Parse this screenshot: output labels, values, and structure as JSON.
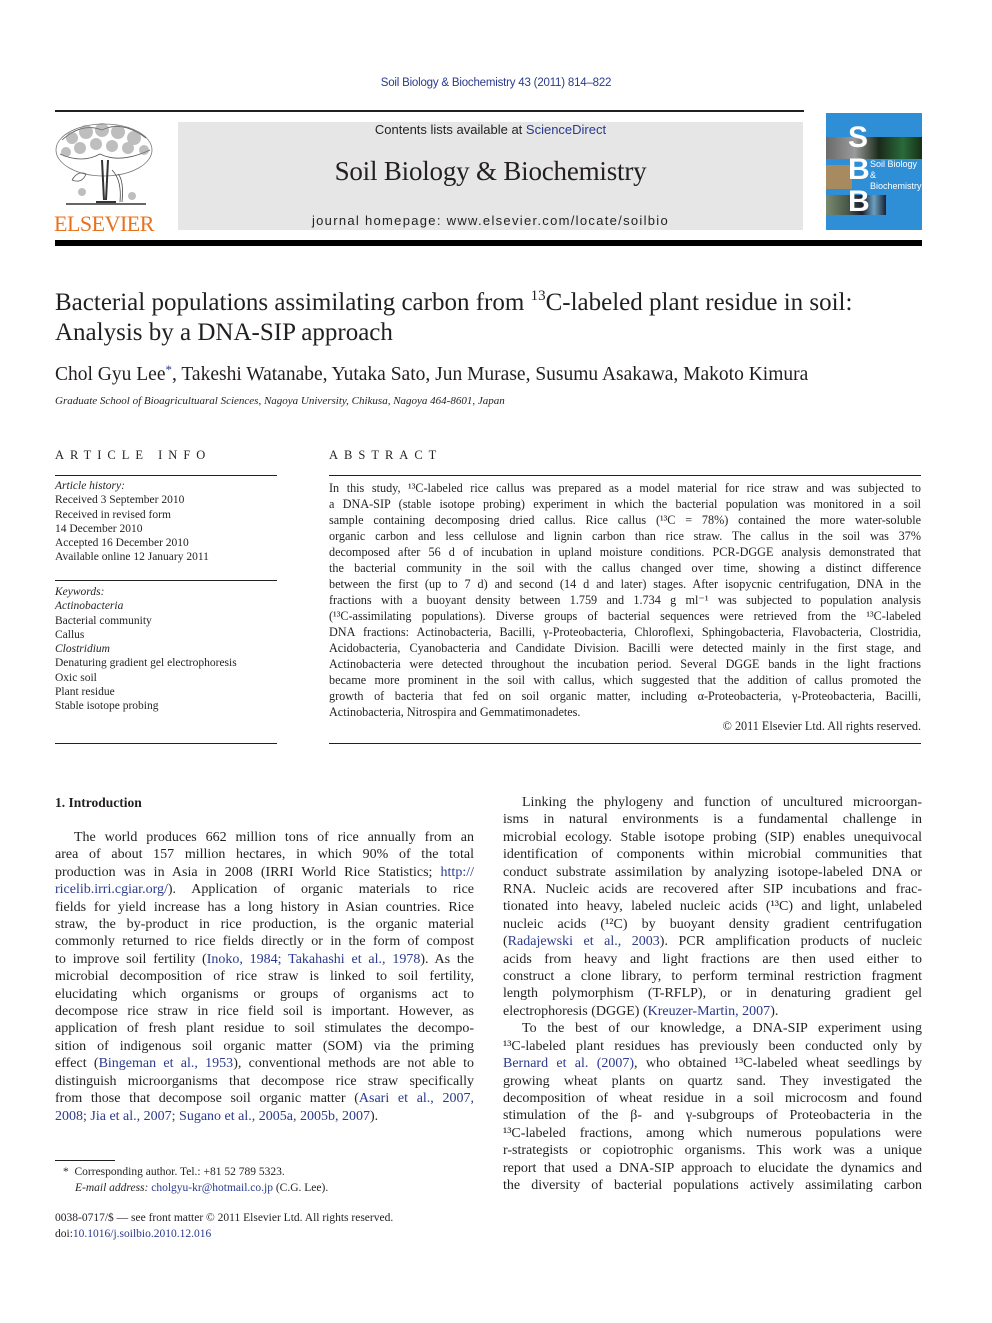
{
  "journal_ref": "Soil Biology & Biochemistry 43 (2011) 814–822",
  "banner": {
    "contents_prefix": "Contents lists available at ",
    "contents_link": "ScienceDirect",
    "journal_name": "Soil Biology & Biochemistry",
    "homepage": "journal homepage: www.elsevier.com/locate/soilbio"
  },
  "publisher_logo_text": "ELSEVIER",
  "cover": {
    "letters": [
      "S",
      "B",
      "B"
    ],
    "caption_line1": "Soil Biology &",
    "caption_line2": "Biochemistry",
    "colors": {
      "background": "#2f8fd6"
    }
  },
  "article": {
    "title_part1": "Bacterial populations assimilating carbon from ",
    "title_sup": "13",
    "title_part2": "C-labeled plant residue in soil:",
    "title_line2": "Analysis by a DNA-SIP approach",
    "first_author": "Chol Gyu Lee",
    "corresponding_mark": "*",
    "other_authors": ", Takeshi Watanabe, Yutaka Sato, Jun Murase, Susumu Asakawa, Makoto Kimura",
    "affiliation": "Graduate School of Bioagricultuaral Sciences, Nagoya University, Chikusa, Nagoya 464-8601, Japan"
  },
  "article_info": {
    "heading": "ARTICLE INFO",
    "history_label": "Article history:",
    "history": [
      "Received 3 September 2010",
      "Received in revised form",
      "14 December 2010",
      "Accepted 16 December 2010",
      "Available online 12 January 2011"
    ],
    "keywords_label": "Keywords:",
    "keywords": [
      {
        "text": "Actinobacteria",
        "italic": true
      },
      {
        "text": "Bacterial community",
        "italic": false
      },
      {
        "text": "Callus",
        "italic": false
      },
      {
        "text": "Clostridium",
        "italic": true
      },
      {
        "text": "Denaturing gradient gel electrophoresis",
        "italic": false
      },
      {
        "text": "Oxic soil",
        "italic": false
      },
      {
        "text": "Plant residue",
        "italic": false
      },
      {
        "text": "Stable isotope probing",
        "italic": false
      }
    ]
  },
  "abstract": {
    "heading": "ABSTRACT",
    "lines": [
      "In this study, ¹³C-labeled rice callus was prepared as a model material for rice straw and was subjected to",
      "a DNA-SIP (stable isotope probing) experiment in which the bacterial population was monitored in a soil",
      "sample containing decomposing dried callus. Rice callus (¹³C = 78%) contained the more water-soluble",
      "organic carbon and less cellulose and lignin carbon than rice straw. The callus in the soil was 37%",
      "decomposed after 56 d of incubation in upland moisture conditions. PCR-DGGE analysis demonstrated that",
      "the bacterial community in the soil with the callus changed over time, showing a distinct difference",
      "between the first (up to 7 d) and second (14 d and later) stages. After isopycnic centrifugation, DNA in the",
      "fractions with a buoyant density between 1.759 and 1.734 g ml⁻¹ was subjected to population analysis",
      "(¹³C-assimilating populations). Diverse groups of bacterial sequences were retrieved from the ¹³C-labeled",
      "DNA fractions: Actinobacteria, Bacilli, γ-Proteobacteria, Chloroflexi, Sphingobacteria, Flavobacteria, Clostridia,",
      "Acidobacteria, Cyanobacteria and Candidate Division. Bacilli were detected mainly in the first stage, and",
      "Actinobacteria were detected throughout the incubation period. Several DGGE bands in the light fractions",
      "became more prominent in the soil with callus, which suggested that the addition of callus promoted the",
      "growth of bacteria that fed on soil organic matter, including α-Proteobacteria, γ-Proteobacteria, Bacilli,",
      "Actinobacteria, Nitrospira and Gemmatimonadetes."
    ],
    "copyright": "© 2011 Elsevier Ltd. All rights reserved."
  },
  "introduction": {
    "heading": "1.  Introduction",
    "col1_lines": [
      "The world produces 662 million tons of rice annually from an",
      "area of about 157 million hectares, in which 90% of the total",
      "production was in Asia in 2008 (IRRI World Rice Statistics; http://",
      "ricelib.irri.cgiar.org/). Application of organic materials to rice",
      "fields for yield increase has a long history in Asian countries. Rice",
      "straw, the by-product in rice production, is the organic material",
      "commonly returned to rice fields directly or in the form of compost",
      "to improve soil fertility (Inoko, 1984; Takahashi et al., 1978). As the",
      "microbial decomposition of rice straw is linked to soil fertility,",
      "elucidating which organisms or groups of organisms act to",
      "decompose rice straw in rice field soil is important. However, as",
      "application of fresh plant residue to soil stimulates the decompo-",
      "sition of indigenous soil organic matter (SOM) via the priming",
      "effect (Bingeman et al., 1953), conventional methods are not able to",
      "distinguish microorganisms that decompose rice straw specifically",
      "from those that decompose soil organic matter (Asari et al., 2007,",
      "2008; Jia et al., 2007; Sugano et al., 2005a, 2005b, 2007)."
    ],
    "col2_lines": [
      "Linking the phylogeny and function of uncultured microorgan-",
      "isms in natural environments is a fundamental challenge in",
      "microbial ecology. Stable isotope probing (SIP) enables unequivocal",
      "identification of components within microbial communities that",
      "conduct substrate assimilation by analyzing isotope-labeled DNA or",
      "RNA. Nucleic acids are recovered after SIP incubations and frac-",
      "tionated into heavy, labeled nucleic acids (¹³C) and light, unlabeled",
      "nucleic acids (¹²C) by buoyant density gradient centrifugation",
      "(Radajewski et al., 2003). PCR amplification products of nucleic",
      "acids from heavy and light fractions are then used either to",
      "construct a clone library, to perform terminal restriction fragment",
      "length polymorphism (T-RFLP), or in denaturing gradient gel",
      "electrophoresis (DGGE) (Kreuzer-Martin, 2007).",
      "To the best of our knowledge, a DNA-SIP experiment using",
      "¹³C-labeled plant residues has previously been conducted only by",
      "Bernard et al. (2007), who obtained ¹³C-labeled wheat seedlings by",
      "growing wheat plants on quartz sand. They investigated the",
      "decomposition of wheat residue in a soil microcosm and found",
      "stimulation of the β- and γ-subgroups of Proteobacteria in the",
      "¹³C-labeled fractions, among which numerous populations were",
      "r-strategists or copiotrophic organisms. This work was a unique",
      "report that used a DNA-SIP approach to elucidate the dynamics and",
      "the diversity of bacterial populations actively assimilating carbon"
    ],
    "citations": [
      "http://ricelib.irri.cgiar.org/",
      "Inoko, 1984",
      "Takahashi et al., 1978",
      "Bingeman et al., 1953",
      "Asari et al., 2007, 2008",
      "Jia et al., 2007",
      "Sugano et al., 2005a, 2005b, 2007",
      "Radajewski et al., 2003",
      "Kreuzer-Martin, 2007",
      "Bernard et al. (2007)"
    ]
  },
  "footnote": {
    "mark": "*",
    "corresponding": "Corresponding author. Tel.: +81 52 789 5323.",
    "email_label": "E-mail address: ",
    "email": "cholgyu-kr@hotmail.co.jp",
    "email_suffix": " (C.G. Lee).",
    "front_matter": "0038-0717/$ — see front matter © 2011 Elsevier Ltd. All rights reserved.",
    "doi_label": "doi:",
    "doi": "10.1016/j.soilbio.2010.12.016"
  },
  "colors": {
    "link": "#2a3a8c",
    "elsevier_orange": "#e9711c",
    "banner_gray": "#e6e6e6"
  }
}
